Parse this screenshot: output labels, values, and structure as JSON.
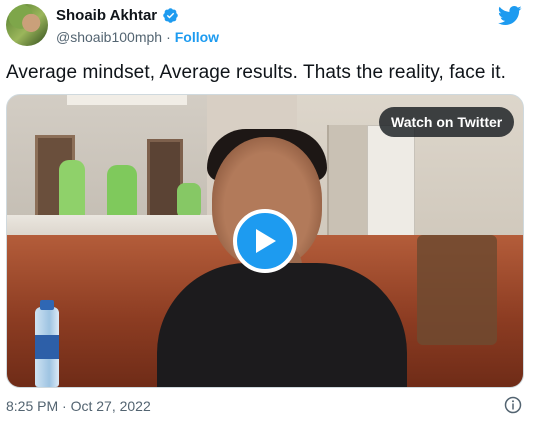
{
  "author": {
    "name": "Shoaib Akhtar",
    "handle": "@shoaib100mph",
    "separator": "·",
    "follow_label": "Follow",
    "verified_icon": "verified-badge-icon"
  },
  "brand": {
    "icon": "twitter-bird-icon",
    "color": "#1d9bf0"
  },
  "tweet": {
    "text": "Average mindset, Average results. Thats the reality, face it."
  },
  "media": {
    "watch_label": "Watch on Twitter",
    "play_icon": "play-icon"
  },
  "footer": {
    "timestamp": "8:25 PM · Oct 27, 2022",
    "info_icon": "info-icon"
  },
  "colors": {
    "accent": "#1d9bf0",
    "text_primary": "#0f1419",
    "text_secondary": "#536471"
  }
}
